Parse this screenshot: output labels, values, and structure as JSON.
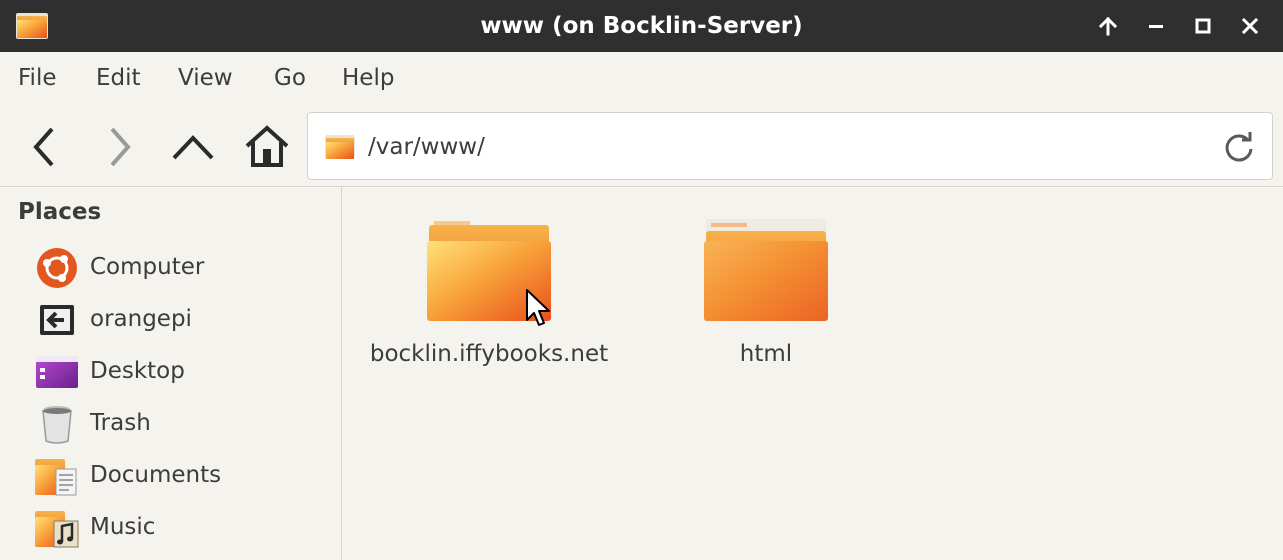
{
  "window": {
    "title": "www (on Bocklin-Server)",
    "icon": "folder-icon",
    "controls": [
      "move-up-icon",
      "minimize-icon",
      "maximize-icon",
      "close-icon"
    ]
  },
  "menubar": {
    "items": [
      {
        "label": "File"
      },
      {
        "label": "Edit"
      },
      {
        "label": "View"
      },
      {
        "label": "Go"
      },
      {
        "label": "Help"
      }
    ]
  },
  "toolbar": {
    "buttons": [
      "back-icon",
      "forward-icon",
      "up-icon",
      "home-icon"
    ],
    "location": {
      "value": "/var/www/",
      "icon": "folder-icon"
    },
    "reload_icon": "reload-icon"
  },
  "sidebar": {
    "heading": "Places",
    "items": [
      {
        "label": "Computer",
        "icon": "computer-icon"
      },
      {
        "label": "orangepi",
        "icon": "network-drive-icon"
      },
      {
        "label": "Desktop",
        "icon": "desktop-icon"
      },
      {
        "label": "Trash",
        "icon": "trash-icon"
      },
      {
        "label": "Documents",
        "icon": "documents-folder-icon"
      },
      {
        "label": "Music",
        "icon": "music-folder-icon"
      }
    ]
  },
  "content": {
    "items": [
      {
        "name": "bocklin.iffybooks.net",
        "icon": "folder-icon"
      },
      {
        "name": "html",
        "icon": "folder-icon"
      }
    ]
  },
  "colors": {
    "titlebar_bg": "#2f2f2f",
    "window_bg": "#f5f3ee",
    "folder_orange": "#f36a1f",
    "folder_yellow": "#ffd86a",
    "text": "#3c3c3c"
  }
}
